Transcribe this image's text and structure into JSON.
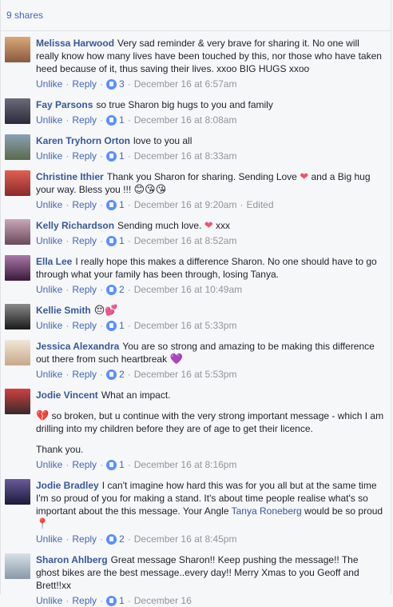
{
  "shares_label": "9 shares",
  "action_labels": {
    "unlike": "Unlike",
    "reply": "Reply",
    "separator": "·"
  },
  "comments": [
    {
      "name": "Melissa Harwood",
      "text": "Very sad reminder & very brave for sharing it. No one will really know how many lives have been touched by this, nor those who have taken heed because of it, thus saving their lives. xxoo BIG HUGS xxoo",
      "likes": "3",
      "time": "December 16 at 6:57am",
      "avatar_color": "#b8865a"
    },
    {
      "name": "Fay Parsons",
      "text": "so true Sharon big hugs to you and family",
      "likes": "1",
      "time": "December 16 at 8:08am",
      "avatar_color": "#4a4a5a"
    },
    {
      "name": "Karen Tryhorn Orton",
      "text": "love to you all",
      "likes": "1",
      "time": "December 16 at 8:33am",
      "avatar_color": "#6a7a5a"
    },
    {
      "name": "Christine Ithier",
      "text_a": "Thank you Sharon for sharing. Sending Love",
      "text_b": "and a Big hug your way. Bless you !!!",
      "emoji_heart": "❤",
      "emoji_faces": "😊😘😘",
      "likes": "1",
      "time": "December 16 at 9:20am",
      "edited": "Edited",
      "avatar_color": "#c44a3a"
    },
    {
      "name": "Kelly Richardson",
      "text_a": "Sending much love.",
      "emoji_heart": "❤",
      "text_b": "xxx",
      "likes": "1",
      "time": "December 16 at 8:52am",
      "avatar_color": "#8a6a7a"
    },
    {
      "name": "Ella Lee",
      "text": "I really hope this makes a difference Sharon. No one should have to go through what your family has been through, losing Tanya.",
      "likes": "2",
      "time": "December 16 at 10:49am",
      "avatar_color": "#5a3a5a"
    },
    {
      "name": "Kellie Smith",
      "emoji": "😔💕",
      "likes": "1",
      "time": "December 16 at 5:33pm",
      "avatar_color": "#3a3a3a"
    },
    {
      "name": "Jessica Alexandra",
      "text": "You are so strong and amazing to be making this difference out there from such heartbreak",
      "emoji": "💜",
      "likes": "2",
      "time": "December 16 at 5:53pm",
      "avatar_color": "#d8c8b8"
    },
    {
      "name": "Jodie Vincent",
      "text": "What an impact.",
      "emoji_broken": "💔",
      "text_p2": "so broken, but u continue with the very strong important message - which I am drilling into my children before they are of age to get their licence.",
      "text_p3": "Thank you.",
      "likes": "1",
      "time": "December 16 at 8:16pm",
      "avatar_color": "#7a2a2a"
    },
    {
      "name": "Jodie Bradley",
      "text_a": "I can't imagine how hard this was for you all but at the same time I'm so proud of you for making a stand. It's about time people realise what's so important about the this message. Your Angle",
      "tag": "Tanya Roneberg",
      "text_b": "would be so proud",
      "emoji": "📍",
      "likes": "2",
      "time": "December 16 at 8:45pm",
      "avatar_color": "#3a2a5a"
    },
    {
      "name": "Sharon Ahlberg",
      "text": "Great message Sharon!! Keep pushing the message!! The ghost bikes are the best message..every day!! Merry Xmas to you Geoff and Brett!!xx",
      "likes": "1",
      "time": "December 16",
      "avatar_color": "#a8b8c8"
    }
  ]
}
